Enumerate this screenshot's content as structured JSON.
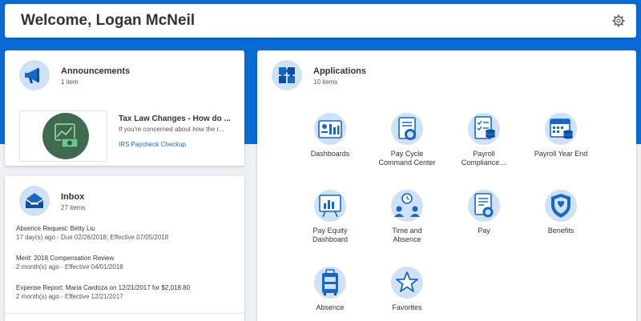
{
  "header": {
    "title": "Welcome, Logan McNeil"
  },
  "announcements": {
    "title": "Announcements",
    "count": "1 item",
    "items": [
      {
        "headline": "Tax Law Changes - How do ...",
        "text": "If you're concerned about how the r...",
        "link": "IRS Paycheck Checkup"
      }
    ]
  },
  "inbox": {
    "title": "Inbox",
    "count": "27 items",
    "items": [
      {
        "line1": "Absence Request: Betty Liu",
        "line2": "17 day(s) ago - Due 02/26/2018; Effective 07/05/2018"
      },
      {
        "line1": "Merit: 2018 Compensation Review",
        "line2": "2 month(s) ago - Effective 04/01/2018"
      },
      {
        "line1": "Expense Report: Maria Cardoza on 12/21/2017 for $2,018.80",
        "line2": "2 month(s) ago - Effective 12/21/2017"
      }
    ]
  },
  "applications": {
    "title": "Applications",
    "count": "10 items",
    "apps": [
      {
        "label1": "Dashboards",
        "label2": "",
        "icon": "dashboards-icon"
      },
      {
        "label1": "Pay Cycle",
        "label2": "Command Center",
        "icon": "pay-cycle-icon"
      },
      {
        "label1": "Payroll",
        "label2": "Compliance…",
        "icon": "payroll-compliance-icon"
      },
      {
        "label1": "Payroll Year End",
        "label2": "",
        "icon": "calendar-coins-icon"
      },
      {
        "label1": "Pay Equity",
        "label2": "Dashboard",
        "icon": "chart-board-icon"
      },
      {
        "label1": "Time and",
        "label2": "Absence",
        "icon": "people-clock-icon"
      },
      {
        "label1": "Pay",
        "label2": "",
        "icon": "pay-icon"
      },
      {
        "label1": "Benefits",
        "label2": "",
        "icon": "shield-icon"
      },
      {
        "label1": "Absence",
        "label2": "",
        "icon": "suitcase-icon"
      },
      {
        "label1": "Favorites",
        "label2": "",
        "icon": "star-icon"
      }
    ]
  },
  "colors": {
    "brand_blue": "#0a6bd6",
    "icon_light": "#cfe1f5",
    "icon_dark": "#1767c4",
    "link": "#1767c4"
  }
}
